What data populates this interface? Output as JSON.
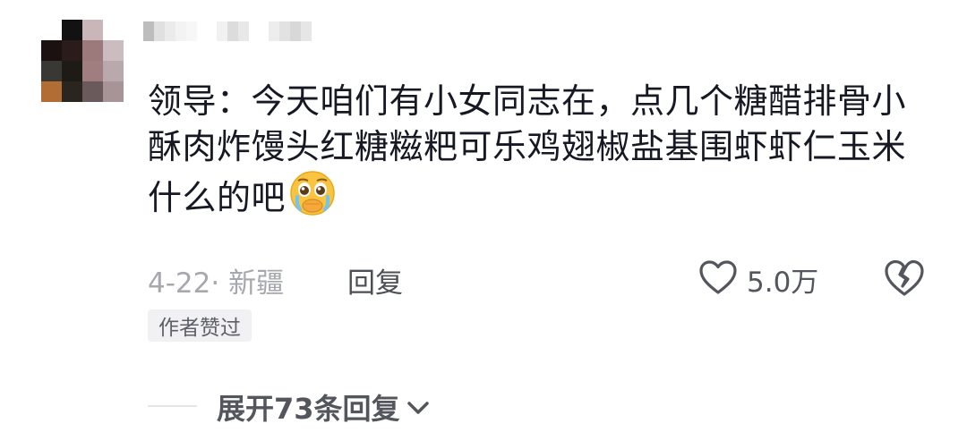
{
  "comment": {
    "text": "领导：今天咱们有小女同志在，点几个糖醋排骨小酥肉炸馒头红糖糍粑可乐鸡翅椒盐基围虾虾仁玉米什么的吧",
    "emoji_icon": "pleading-face-crying-emoji"
  },
  "meta": {
    "date_location": "4-22· 新疆",
    "reply_label": "回复"
  },
  "actions": {
    "like_count": "5.0万",
    "like_icon": "heart-outline-icon",
    "dislike_icon": "broken-heart-icon"
  },
  "badge": {
    "label": "作者赞过"
  },
  "expand": {
    "label": "展开73条回复",
    "icon": "chevron-down-icon"
  },
  "colors": {
    "text_primary": "#161823",
    "text_secondary": "#a6a8ad",
    "action_text": "#54565e",
    "badge_bg": "#f1f1f3"
  }
}
